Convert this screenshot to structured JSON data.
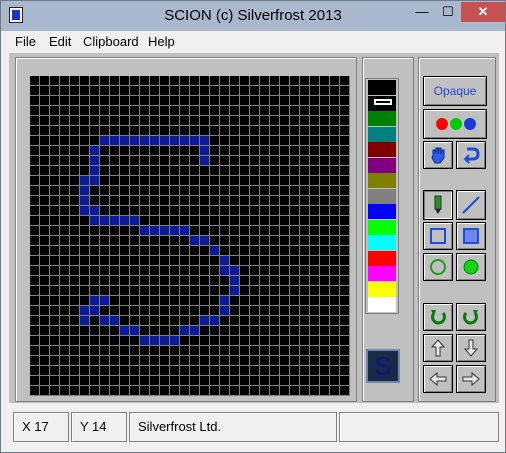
{
  "window": {
    "title": "SCION  (c) Silverfrost 2013",
    "min": "—",
    "max": "☐",
    "close": "✕"
  },
  "menu": [
    {
      "label": "File"
    },
    {
      "label": "Edit"
    },
    {
      "label": "Clipboard"
    },
    {
      "label": "Help"
    }
  ],
  "canvas": {
    "size": 32,
    "background": "#000000",
    "grid_color": "#7f7f7f",
    "pixel_color": "#0a1a9a",
    "pixels": [
      "7,6",
      "8,6",
      "9,6",
      "10,6",
      "11,6",
      "12,6",
      "13,6",
      "14,6",
      "15,6",
      "16,6",
      "17,6",
      "17,7",
      "17,8",
      "6,7",
      "6,8",
      "6,9",
      "6,10",
      "5,10",
      "5,11",
      "5,12",
      "5,13",
      "6,13",
      "6,14",
      "7,14",
      "8,14",
      "9,14",
      "10,14",
      "11,15",
      "12,15",
      "13,15",
      "14,15",
      "15,15",
      "16,16",
      "17,16",
      "18,17",
      "19,18",
      "19,19",
      "20,19",
      "20,20",
      "20,21",
      "19,22",
      "19,23",
      "18,24",
      "17,24",
      "16,25",
      "15,25",
      "14,26",
      "13,26",
      "12,26",
      "11,26",
      "10,25",
      "9,25",
      "8,24",
      "7,24",
      "6,23",
      "5,23",
      "5,24",
      "6,22",
      "7,22"
    ]
  },
  "palette": {
    "colors": [
      "#000000",
      "#ffffff",
      "#008000",
      "#008080",
      "#800000",
      "#800080",
      "#808000",
      "#808080",
      "#0000ff",
      "#00ff00",
      "#00ffff",
      "#ff0000",
      "#ff00ff",
      "#ffff00",
      "#ffffff"
    ],
    "selected_index": 1
  },
  "preview": {
    "glyph": "S"
  },
  "tools": {
    "opaque_label": "Opaque",
    "dots": [
      "#ff0000",
      "#00cc00",
      "#1a3bd6"
    ]
  },
  "status": {
    "x": "X 17",
    "y": "Y 14",
    "company": "Silverfrost Ltd.",
    "extra": ""
  }
}
